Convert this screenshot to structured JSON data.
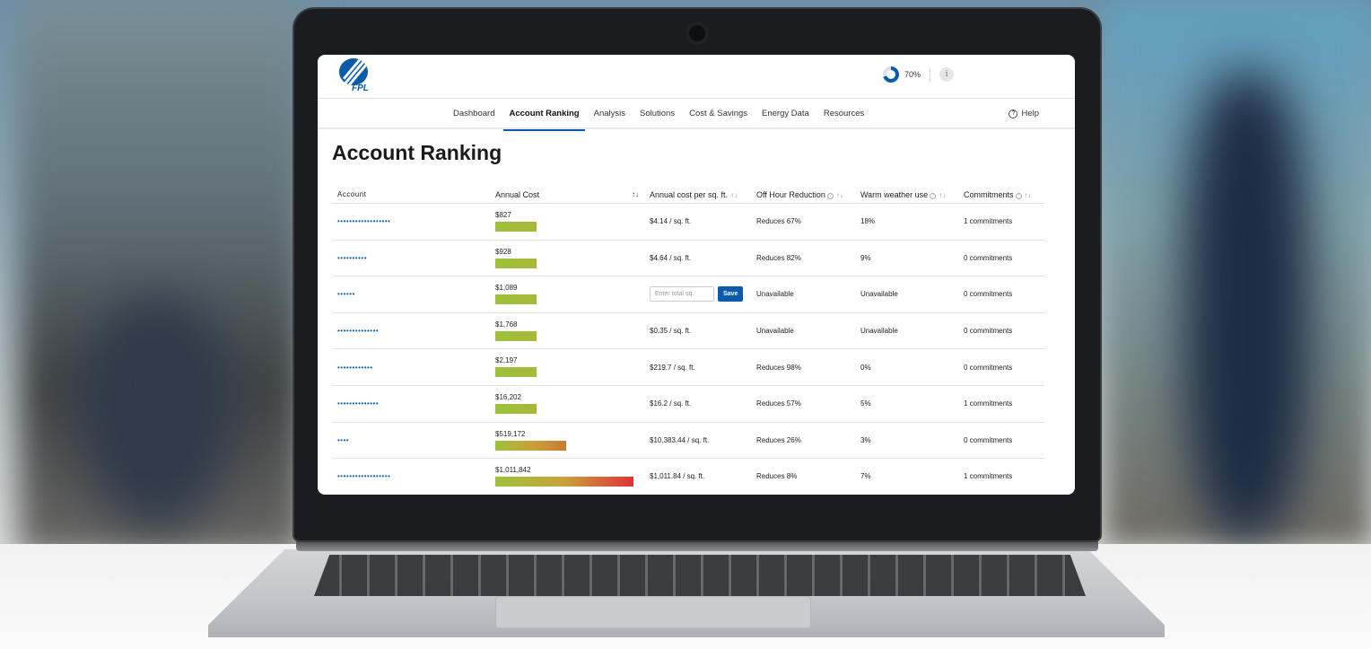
{
  "header": {
    "logo_text": "FPL",
    "progress_label": "70%",
    "progress_fraction": 0.7,
    "info_icon": "i"
  },
  "nav": {
    "tabs": [
      {
        "label": "Dashboard",
        "active": false
      },
      {
        "label": "Account Ranking",
        "active": true
      },
      {
        "label": "Analysis",
        "active": false
      },
      {
        "label": "Solutions",
        "active": false
      },
      {
        "label": "Cost & Savings",
        "active": false
      },
      {
        "label": "Energy Data",
        "active": false
      },
      {
        "label": "Resources",
        "active": false
      }
    ],
    "help_label": "Help"
  },
  "page": {
    "title": "Account Ranking"
  },
  "table": {
    "columns": {
      "account": "Account",
      "annual_cost": "Annual Cost",
      "cost_per_sqft": "Annual cost per sq. ft.",
      "off_hour": "Off Hour Reduction",
      "warm_weather": "Warm weather use",
      "commitments": "Commitments"
    },
    "sqft_placeholder": "Enter total sq.",
    "save_label": "Save",
    "max_cost": 1011842,
    "rows": [
      {
        "account": "••••••••••••••••••",
        "cost_label": "$827",
        "cost": 827,
        "sqft": "$4.14 / sq. ft.",
        "off_hour": "Reduces 67%",
        "warm": "18%",
        "commitments": "1 commitments"
      },
      {
        "account": "••••••••••",
        "cost_label": "$928",
        "cost": 928,
        "sqft": "$4.64 / sq. ft.",
        "off_hour": "Reduces 82%",
        "warm": "9%",
        "commitments": "0 commitments"
      },
      {
        "account": "••••••",
        "cost_label": "$1,089",
        "cost": 1089,
        "sqft": null,
        "off_hour": "Unavailable",
        "warm": "Unavailable",
        "commitments": "0 commitments"
      },
      {
        "account": "••••••••••••••",
        "cost_label": "$1,768",
        "cost": 1768,
        "sqft": "$0.35 / sq. ft.",
        "off_hour": "Unavailable",
        "warm": "Unavailable",
        "commitments": "0 commitments"
      },
      {
        "account": "••••••••••••",
        "cost_label": "$2,197",
        "cost": 2197,
        "sqft": "$219.7 / sq. ft.",
        "off_hour": "Reduces 98%",
        "warm": "0%",
        "commitments": "0 commitments"
      },
      {
        "account": "••••••••••••••",
        "cost_label": "$16,202",
        "cost": 16202,
        "sqft": "$16.2 / sq. ft.",
        "off_hour": "Reduces 57%",
        "warm": "5%",
        "commitments": "1 commitments"
      },
      {
        "account": "••••",
        "cost_label": "$519,172",
        "cost": 519172,
        "sqft": "$10,383.44 / sq. ft.",
        "off_hour": "Reduces 26%",
        "warm": "3%",
        "commitments": "0 commitments"
      },
      {
        "account": "••••••••••••••••••",
        "cost_label": "$1,011,842",
        "cost": 1011842,
        "sqft": "$1,011.84 / sq. ft.",
        "off_hour": "Reduces 8%",
        "warm": "7%",
        "commitments": "1 commitments"
      }
    ]
  },
  "colors": {
    "brand": "#0a5bab",
    "bar_low": "#9cc23a",
    "bar_high": "#e0333a"
  }
}
